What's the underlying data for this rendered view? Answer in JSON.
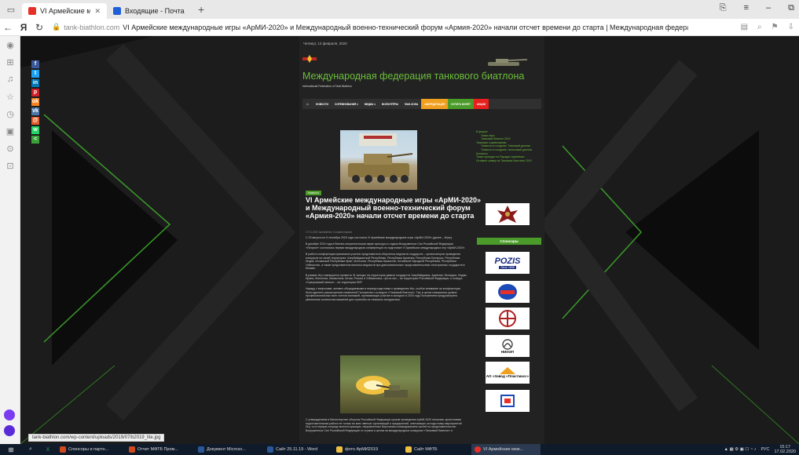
{
  "browser": {
    "tabs": [
      {
        "label": "VI Армейские междуна",
        "favicon_color": "#e8302a",
        "active": true
      },
      {
        "label": "Входящие - Почта Mail.ru",
        "favicon_color": "#1e5fd8",
        "active": false
      }
    ],
    "address": {
      "domain": "tank-biathlon.com",
      "title": "VI Армейские международные игры «АрМИ-2020» и Международный военно-технический форум «Армия-2020» начали отсчет времени до старта | Международная федерация танко..."
    },
    "status_url": "tank-biathlon.com/wp-content/uploads/2019/07/b2019_lite.jpg"
  },
  "site": {
    "date": "Четверг, 13 февраля, 2020",
    "title": "Международная федерация танкового биатлона",
    "subtitle": "International Federation of Tank Biathlon",
    "menu": [
      {
        "label": "НОВОСТИ",
        "style": "plain"
      },
      {
        "label": "СОРЕВНОВАНИЯ ▾",
        "style": "plain"
      },
      {
        "label": "МЕДИА ▾",
        "style": "plain"
      },
      {
        "label": "ВОЛОНТЁРЫ",
        "style": "plain"
      },
      {
        "label": "ФАН-ЗОНА",
        "style": "plain"
      },
      {
        "label": "АККРЕДИТАЦИЯ",
        "style": "orange"
      },
      {
        "label": "КУПИТЬ БИЛЕТ",
        "style": "green"
      },
      {
        "label": "АКЦИИ",
        "style": "red"
      }
    ]
  },
  "article": {
    "category": "Новости",
    "headline": "VI Армейские международные игры «АрМИ-2020» и Международный военно-технический форум «Армия-2020» начали отсчет времени до старта",
    "meta": "17.01.2020   tankbiathlon   0 комментариев",
    "paragraphs": [
      "С 23 августа по 5 сентября 2020 года состоятся VI Армейские международные игры «АрМИ-2020» (далее – Игры).",
      "В декабре 2019 года в Военно-патриотическом парке культуры и отдыха Вооруженных Сил Российской Федерации «Патриот» состоялась первая международная конференция по подготовке VI Армейских международных игр «АрМИ-2020».",
      "В работе конференции принимали участие представители оборонных ведомств государств – организаторов проведения конкурсов на своей территории: Азербайджанской Республики, Республики Армения, Республики Беларусь, Республики Индия, Исламской Республики Иран, Монголии, Республики Казахстан, Китайской Народной Республики, Республики Узбекистан, а также представители военных ведомств при дипломатических представительствах иностранных государств в Москве.",
      "В рамках Игр планируется провести 31 конкурс на территории девяти государств: Азербайджана, Армении, Беларуси, Индии, Ирана, Монголии, Казахстана, Китая, России и Узбекистана, три из них – на территории Российской Федерации, и конкурс «Суворовский натиск» – на территории КНР.",
      "Наряду с вопросами, активно обсуждаемыми в период подготовки к проведению Игр, особое внимание на конференции было уделено рассмотрению изменений Положения о конкурсе «Танковый биатлон». Так, в целях повышения уровня профессиональных всех членов экипажей, принимающих участие в конкурсе в 2020 году Положением предусмотрено увеличение количества мишеней для стрельбы из танкового вооружения."
    ],
    "paragraph_after_photo": "С утверждением в Министерстве обороны Российской Федерации сроков проведения АрМИ-2020 начались кропотливые подготовительная работа не только во всех звеньях организаций и предприятий, отвечающих за подготовку мероприятий Игр, но в первую очередь военнослужащих, направленных Верховным командованием частей на представительство Вооруженных Сил Российской Федерации от страны в целом на международных конкурсах «Танковый биатлон» и"
  },
  "sidebar": {
    "links": [
      {
        "label": "В фокусе",
        "indent": false
      },
      {
        "label": "Танки игры",
        "indent": true
      },
      {
        "label": "Танковый биатлон 2019",
        "indent": true
      },
      {
        "label": "Танковые соревнования",
        "indent": false
      },
      {
        "label": "Танкисты в солдатах: Танковый диплом",
        "indent": true
      },
      {
        "label": "Танкисты в солдатах: полосовый диплом",
        "indent": true
      },
      {
        "label": "Контакты",
        "indent": false
      },
      {
        "label": "Танки проходят на Парадах Армейских",
        "indent": false
      },
      {
        "label": "Оставьте заявку на Танковом биатлоне 2019",
        "indent": false
      }
    ],
    "sponsors_title": "Спонсоры",
    "sponsors": [
      {
        "name": "POZIS",
        "sub": "Since 1898"
      },
      {
        "name": "УВЗ"
      },
      {
        "name": "ИЖМАШ"
      },
      {
        "name": "НИИЭП"
      },
      {
        "name": "АО «Завод «Пластмасс»"
      },
      {
        "name": "КМЗ"
      }
    ]
  },
  "taskbar": {
    "items": [
      {
        "label": "Спонсоры и партн...",
        "color": "#d04a1e"
      },
      {
        "label": "Отчет МФТБ Пром...",
        "color": "#d04a1e"
      },
      {
        "label": "Документ Microso...",
        "color": "#2b5797"
      },
      {
        "label": "Сайт 25.11.19 - Word",
        "color": "#2b5797"
      },
      {
        "label": "фото АрМИ2019",
        "color": "#f0c040"
      },
      {
        "label": "Сайт МФТБ",
        "color": "#f0c040"
      },
      {
        "label": "VI Армейские меж...",
        "color": "#e8302a",
        "active": true
      }
    ],
    "lang": "РУС",
    "time": "15:17",
    "date": "17.02.2020"
  },
  "colors": {
    "accent_green": "#6cbf3c",
    "orange": "#f0a020",
    "red": "#e8201e"
  }
}
